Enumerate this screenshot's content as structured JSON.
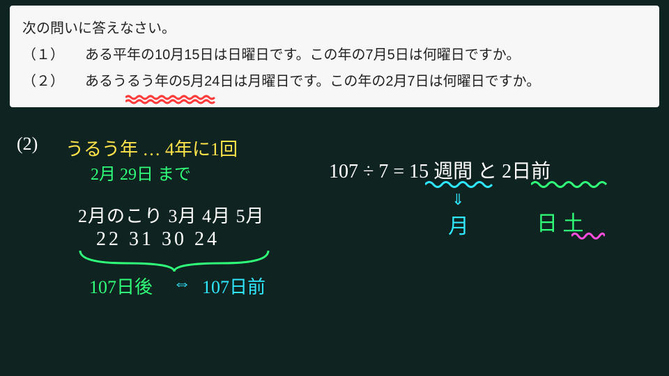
{
  "problem": {
    "instruction": "次の問いに答えなさい。",
    "q1_num": "（１）",
    "q1_body": "ある平年の10月15日は日曜日です。この年の7月5日は何曜日ですか。",
    "q2_num": "（２）",
    "q2_body": "あるうるう年の5月24日は月曜日です。この年の2月7日は何曜日ですか。"
  },
  "work": {
    "label_q2": "(2)",
    "leap_note": "うるう年 … 4年に1回",
    "feb_note": "2月 29日 まで",
    "months_row": "2月のこり  3月  4月  5月",
    "days_row": " 22   31  30  24",
    "sum_after": "107日後",
    "arrow_lr": "⇔",
    "sum_before": "107日前",
    "division": "107 ÷ 7 = 15 週間 と 2日前",
    "arrow_down": "⇓",
    "mon": "月",
    "sun_sat": "日  土"
  }
}
